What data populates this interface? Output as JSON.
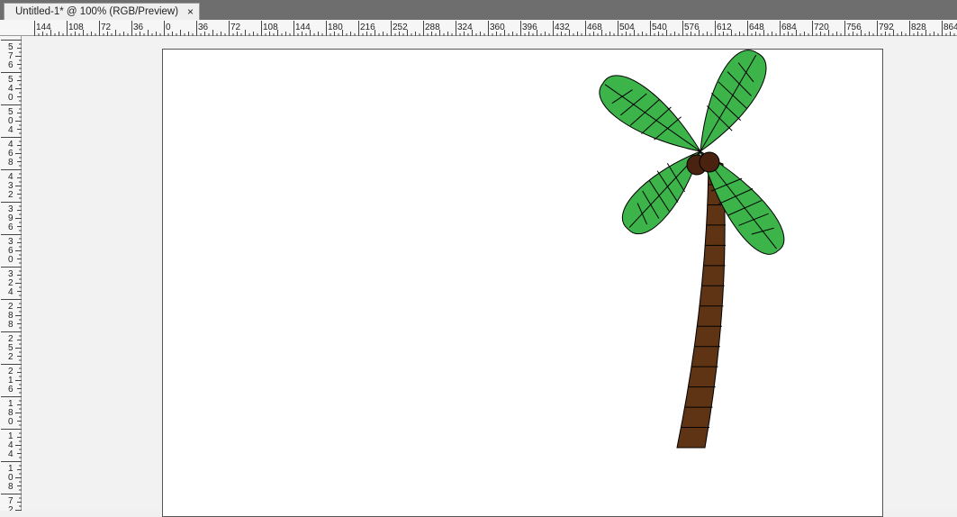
{
  "document_tab": {
    "title": "Untitled-1* @ 100% (RGB/Preview)",
    "close_glyph": "×"
  },
  "horizontal_ruler": {
    "labels": [
      "144",
      "108",
      "72",
      "36",
      "0",
      "36",
      "72",
      "108",
      "144",
      "180",
      "216",
      "252",
      "288",
      "324",
      "360",
      "396",
      "432",
      "468",
      "504",
      "540",
      "576",
      "612",
      "648",
      "684",
      "720",
      "756",
      "792",
      "828",
      "864"
    ]
  },
  "vertical_ruler": {
    "labels": [
      "576",
      "540",
      "504",
      "468",
      "432",
      "396",
      "360",
      "324",
      "288",
      "252",
      "216",
      "180",
      "144",
      "108",
      "72"
    ]
  },
  "colors": {
    "leaf_fill": "#3cb44a",
    "trunk_fill": "#5e3414",
    "coconut_fill": "#4a2210",
    "stroke": "#000000"
  },
  "artwork": {
    "name": "palm-tree",
    "leaf_count": 4,
    "trunk_segment_count": 13
  }
}
